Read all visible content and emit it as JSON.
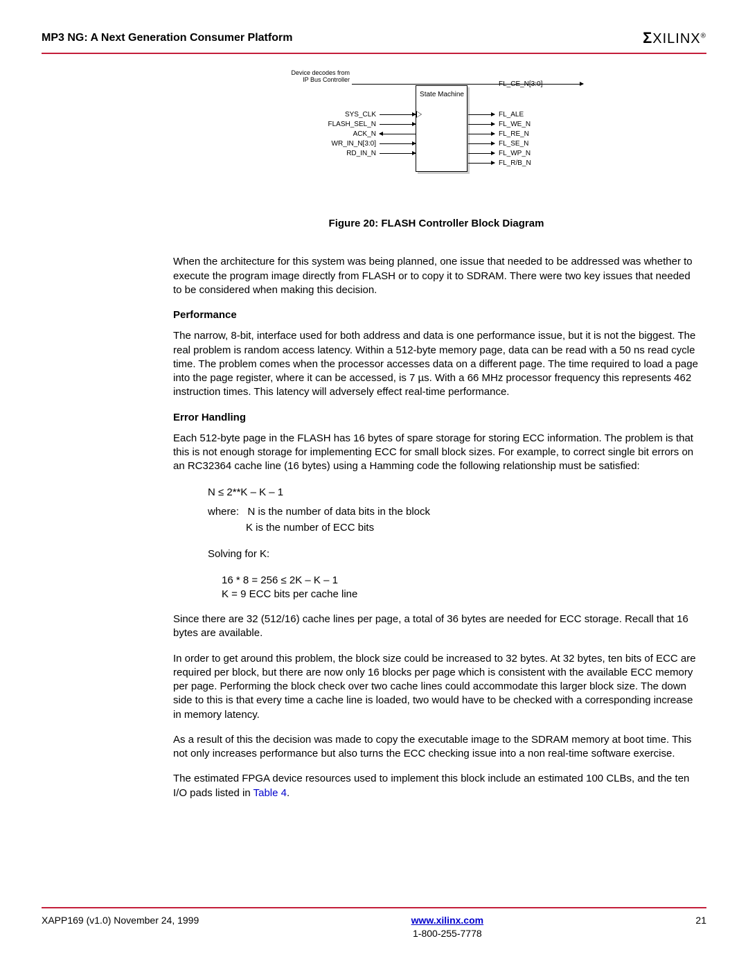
{
  "header": {
    "title": "MP3 NG: A Next Generation Consumer Platform",
    "brand_sigma": "Σ",
    "brand_text": "XILINX",
    "brand_reg": "®"
  },
  "diagram": {
    "note": "Device decodes from IP Bus Controller",
    "center_label": "State Machine",
    "left_signals": [
      "SYS_CLK",
      "FLASH_SEL_N",
      "ACK_N",
      "WR_IN_N[3:0]",
      "RD_IN_N"
    ],
    "right_signals": [
      "FL_CE_N[3:0]",
      "FL_ALE",
      "FL_WE_N",
      "FL_RE_N",
      "FL_SE_N",
      "FL_WP_N",
      "FL_R/B_N"
    ]
  },
  "figure_caption": "Figure 20:  FLASH Controller Block Diagram",
  "body": {
    "p1": "When the architecture for this system was being planned, one issue that needed to be addressed was whether to execute the program image directly from FLASH or to copy it to SDRAM. There were two key issues that needed to be considered when making this decision.",
    "h1": "Performance",
    "p2": "The narrow, 8-bit, interface used for both address and data is one performance issue, but it is not the biggest. The real problem is random access latency. Within a 512-byte memory page, data can be read with a 50 ns read cycle time. The problem comes when the processor accesses data on a different page. The time required to load a page into the page register, where it can be accessed, is 7 µs. With a 66 MHz processor frequency this represents 462 instruction times. This latency will adversely effect real-time performance.",
    "h2": "Error Handling",
    "p3": "Each 512-byte page in the FLASH has 16 bytes of spare storage for storing ECC information. The problem is that this is not enough storage for implementing ECC for small block sizes. For example, to correct single bit errors on an RC32364 cache line (16 bytes) using a Hamming code the following relationship must be satisfied:",
    "formula1_a": "N ≤ 2**K – K – 1",
    "formula1_b": "where:",
    "formula1_c": "N is the number of data bits in the block",
    "formula1_d": "K is the number of ECC bits",
    "formula2_a": "Solving for K:",
    "formula2_b": "16 * 8 = 256 ≤ 2K – K – 1",
    "formula2_c": "K = 9 ECC bits per cache line",
    "p4": "Since there are 32 (512/16) cache lines per page, a total of 36 bytes are needed for ECC storage. Recall that 16 bytes are available.",
    "p5": "In order to get around this problem, the block size could be increased to 32 bytes. At 32 bytes, ten bits of ECC are required per block, but there are now only 16 blocks per page which is consistent with the available ECC memory per page. Performing the block check over two cache lines could accommodate this larger block size. The down side to this is that every time a cache line is loaded, two would have to be checked with a corresponding increase in memory latency.",
    "p6": "As a result of this the decision was made to copy the executable image to the SDRAM memory at boot time. This not only increases performance but also turns the ECC checking issue into a non real-time software exercise.",
    "p7_a": "The estimated FPGA device resources used to implement this block include an estimated 100 CLBs, and the ten I/O pads listed in ",
    "p7_link": "Table 4",
    "p7_b": "."
  },
  "footer": {
    "left": "XAPP169 (v1.0) November 24, 1999",
    "url": "www.xilinx.com",
    "phone": "1-800-255-7778",
    "page": "21"
  }
}
